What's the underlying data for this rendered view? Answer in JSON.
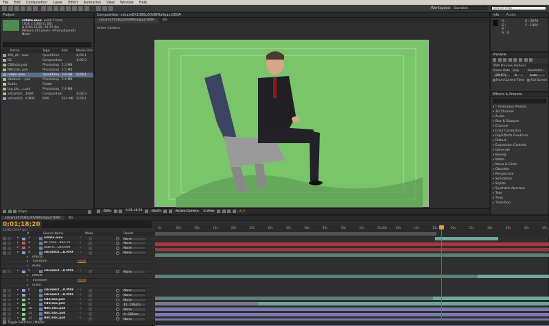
{
  "menu": [
    "File",
    "Edit",
    "Composition",
    "Layer",
    "Effect",
    "Animation",
    "View",
    "Window",
    "Help"
  ],
  "workspace": {
    "label": "Workspace:",
    "value": "Standard",
    "search": "Search Help"
  },
  "project": {
    "tab": "Project",
    "selected_name": "rotate.mov",
    "selected_used": ", used 1 time",
    "info_lines": [
      "1920 x 1080 (1.00)",
      "Δ 0;00;16;28, 29.97 fps",
      "Millions of Colors+ (Premultiplied)",
      "None"
    ],
    "columns": [
      "Name",
      "Type",
      "Size",
      "Media Dura"
    ],
    "items": [
      {
        "name": "40k_df....mov",
        "type": "QuickTime",
        "size": "",
        "dur": "0;00;1",
        "color": "#8aa3c9"
      },
      {
        "name": "BG",
        "type": "Composition",
        "size": "",
        "dur": "0;00;3",
        "color": "#c9a98a"
      },
      {
        "name": "CBS/cbs.psd",
        "type": "Photoshop",
        "size": "2.3 MB",
        "dur": "",
        "color": "#8ac98f"
      },
      {
        "name": "NBC/nbc.psd",
        "type": "Photoshop",
        "size": "5.5 MB",
        "dur": "",
        "color": "#8ac98f"
      },
      {
        "name": "rotate.mov",
        "type": "QuickTime",
        "size": "3.9 GB",
        "dur": "0;00;1",
        "color": "#8aa3c9"
      },
      {
        "name": "sitedesc....psd",
        "type": "Photoshop",
        "size": "5.4 MB",
        "dur": "",
        "color": "#8ac98f"
      },
      {
        "name": "Solids",
        "type": "Folder",
        "size": "",
        "dur": "",
        "color": "#d9c76a"
      },
      {
        "name": "top_blu...s.psd",
        "type": "Photoshop",
        "size": "7.9 MB",
        "dur": "",
        "color": "#8ac98f"
      },
      {
        "name": "xdcamEX...169A",
        "type": "Composition",
        "size": "",
        "dur": "0;00;3",
        "color": "#c9a98a"
      },
      {
        "name": "xdcamEX...A.MXF",
        "type": "MXF",
        "size": "524 MB",
        "dur": "0;00;1",
        "color": "#8aa3c9"
      }
    ],
    "bpc": "8 bpc"
  },
  "composition": {
    "tab": "Composition: xdcamEX1080p30VBRfullqaut169A",
    "subtabs": [
      "xdcamEX1080p30VBRfullqaut169A",
      "BG"
    ],
    "camera": "Active Camera",
    "footer": {
      "zoom": "50%",
      "timecode": "0;01;18;20",
      "res": "(Half)",
      "view": "Active Camera",
      "views": "1 View",
      "exposure": "+0.0"
    }
  },
  "info": {
    "tab": "Info",
    "tab2": "Audio",
    "lines": [
      "R :",
      "G :",
      "B :",
      "A : 0"
    ],
    "coords": [
      "X : 2076",
      "Y : 1064"
    ]
  },
  "preview": {
    "tab": "Preview",
    "ram": "RAM Preview Options",
    "labels": [
      "Frame Rate",
      "Skip",
      "Resolution"
    ],
    "values": [
      "(29.97)",
      "0",
      "Auto"
    ],
    "from_current": "From Current Time",
    "full_screen": "Full Screen"
  },
  "effects": {
    "tab": "Effects & Presets",
    "items": [
      "* Animation Presets",
      "3D Channel",
      "Audio",
      "Blur & Sharpen",
      "Channel",
      "Color Correction",
      "DigiEffects FreeForm",
      "Distort",
      "Expression Controls",
      "Generate",
      "Keying",
      "Matte",
      "Noise & Grain",
      "Obsolete",
      "Perspective",
      "Simulation",
      "Stylize",
      "Synthetic Aperture",
      "Text",
      "Time",
      "Transition"
    ]
  },
  "timeline": {
    "tabs": [
      "xdcamEX1080p30VBRfullqaut169A",
      "BG"
    ],
    "timecode": "0;01;18;20",
    "timecode_sub": "02360 (29.97 fps)",
    "columns": [
      "#",
      "Source Name",
      "Mode",
      "Parent"
    ],
    "ruler": [
      "0s",
      "05s",
      "10s",
      "15s",
      "20s",
      "25s",
      "30s",
      "35s",
      "40s",
      "45s",
      "50s",
      "55s",
      "01:00s",
      "05s",
      "10s",
      "15s",
      "20s",
      "25s",
      "30s",
      "35s",
      "40s",
      "45s"
    ],
    "layers": [
      {
        "num": "1",
        "name": "rotate.mov",
        "parent": "None",
        "color": "#8aa3c9",
        "bold": true
      },
      {
        "num": "2",
        "name": "BS Chan...IRECTV",
        "parent": "None",
        "color": "#c45a5a",
        "bold": false
      },
      {
        "num": "3",
        "name": "Auto-Ir....05A.MXF",
        "parent": "None",
        "color": "#c45a5a",
        "bold": false
      },
      {
        "num": "4",
        "name": "xdcamEX...A.MXF",
        "parent": "None",
        "color": "#8aa3c9",
        "bold": true
      },
      {
        "sub": "Effects"
      },
      {
        "sub": "Transform",
        "reset": "Reset"
      },
      {
        "sub": "Audio"
      },
      {
        "num": "5",
        "name": "xdcamEX...A.MXF",
        "parent": "None",
        "color": "#8aa3c9",
        "bold": true
      },
      {
        "sub": "Effects"
      },
      {
        "sub": "Transform",
        "reset": "Reset"
      },
      {
        "sub": "Audio"
      },
      {
        "num": "6",
        "name": "xdcamEX...A.MXF",
        "parent": "None",
        "color": "#8aa3c9",
        "bold": true
      },
      {
        "num": "7",
        "name": "xdcamEX...A.MXF",
        "parent": "None",
        "color": "#8aa3c9",
        "bold": true
      },
      {
        "num": "8",
        "name": "CBS/cbs.psd",
        "parent": "None",
        "color": "#8ac98f",
        "bold": true
      },
      {
        "num": "9",
        "name": "CBS/cbs.psd",
        "parent": "11. CBS/ch",
        "color": "#8ac98f",
        "bold": true
      },
      {
        "num": "10",
        "name": "NBC/nbc.psd",
        "parent": "None",
        "color": "#8ac98f",
        "bold": true
      },
      {
        "num": "11",
        "name": "NBC/nbc.psd",
        "parent": "9. CBS/ch",
        "color": "#8ac98f",
        "bold": true
      },
      {
        "num": "12",
        "name": "NBC/nbc.psd",
        "parent": "None",
        "color": "#8ac98f",
        "bold": true
      }
    ],
    "footer": "Toggle Switches / Modes"
  }
}
